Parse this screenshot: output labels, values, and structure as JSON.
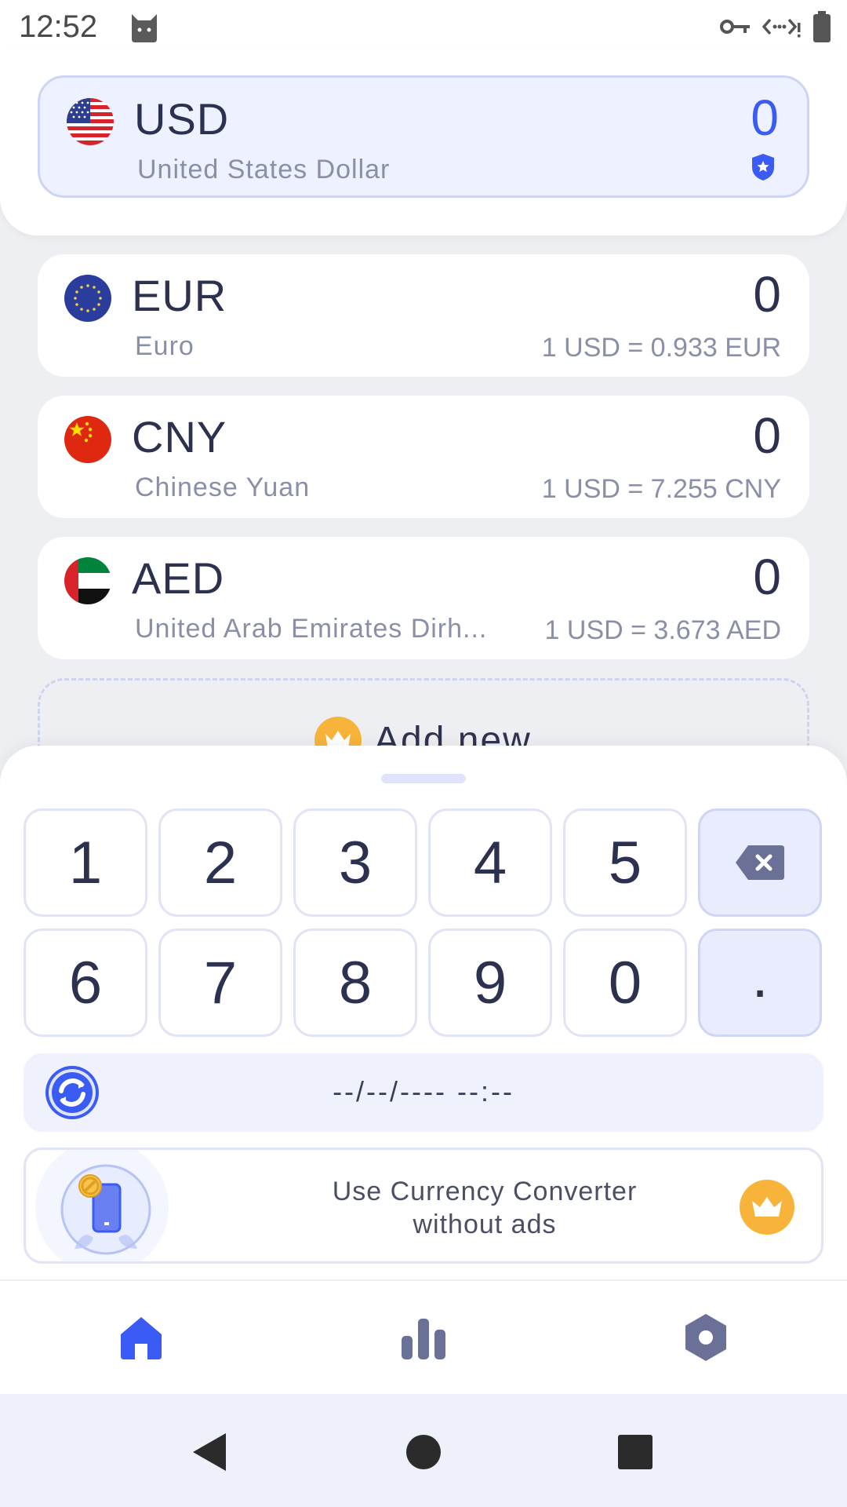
{
  "status_bar": {
    "time": "12:52",
    "icons": [
      "cat-icon",
      "vpn-key-icon",
      "data-saver-icon",
      "battery-icon"
    ]
  },
  "base_currency": {
    "code": "USD",
    "name": "United States Dollar",
    "value": "0",
    "badge_icon": "shield-star-icon",
    "flag_icon": "us-flag-icon",
    "accent_color": "#3b5bf5"
  },
  "currencies": [
    {
      "code": "EUR",
      "name": "Euro",
      "value": "0",
      "rate": "1 USD = 0.933 EUR",
      "flag_icon": "eu-flag-icon"
    },
    {
      "code": "CNY",
      "name": "Chinese Yuan",
      "value": "0",
      "rate": "1 USD = 7.255 CNY",
      "flag_icon": "cn-flag-icon"
    },
    {
      "code": "AED",
      "name": "United Arab Emirates Dirh...",
      "value": "0",
      "rate": "1 USD = 3.673 AED",
      "flag_icon": "ae-flag-icon"
    }
  ],
  "add_new": {
    "label": "Add new",
    "icon": "crown-icon"
  },
  "keypad": {
    "row1": [
      "1",
      "2",
      "3",
      "4",
      "5"
    ],
    "row2": [
      "6",
      "7",
      "8",
      "9",
      "0"
    ],
    "backspace_icon": "backspace-icon",
    "decimal": "."
  },
  "update_bar": {
    "datetime": "--/--/---- --:--",
    "icon": "refresh-icon"
  },
  "promo": {
    "line1": "Use Currency Converter",
    "line2": "without ads",
    "icon": "no-ads-phone-icon",
    "crown_color": "#f8b43a"
  },
  "bottom_nav": {
    "items": [
      "home-icon",
      "chart-icon",
      "settings-icon"
    ],
    "active": "home-icon",
    "active_color": "#3b5bf5",
    "inactive_color": "#6b7196"
  },
  "system_nav": [
    "back-icon",
    "home-circle-icon",
    "recents-icon"
  ]
}
